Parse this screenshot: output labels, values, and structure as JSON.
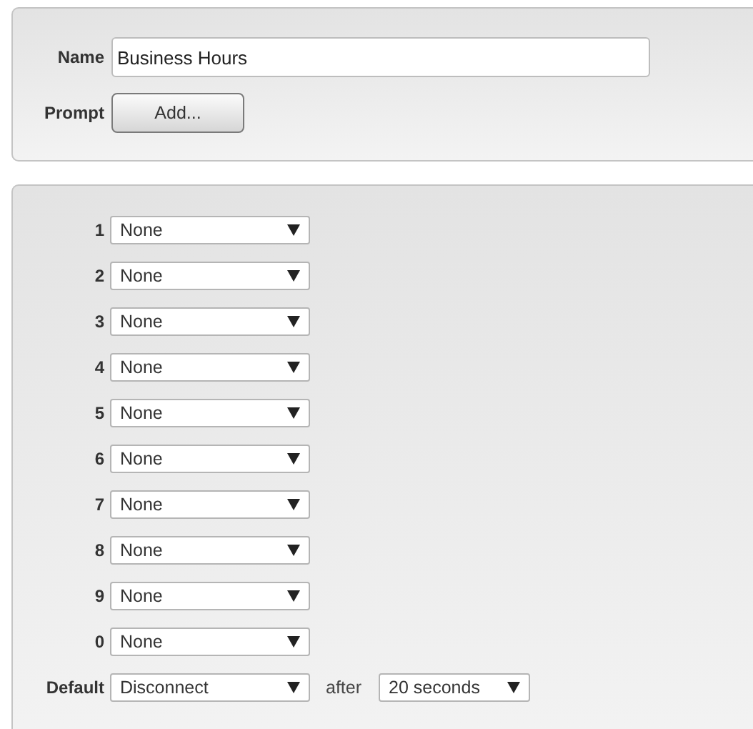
{
  "name_field": {
    "label": "Name",
    "value": "Business Hours"
  },
  "prompt": {
    "label": "Prompt",
    "button": "Add..."
  },
  "keys": [
    {
      "key": "1",
      "action": "None"
    },
    {
      "key": "2",
      "action": "None"
    },
    {
      "key": "3",
      "action": "None"
    },
    {
      "key": "4",
      "action": "None"
    },
    {
      "key": "5",
      "action": "None"
    },
    {
      "key": "6",
      "action": "None"
    },
    {
      "key": "7",
      "action": "None"
    },
    {
      "key": "8",
      "action": "None"
    },
    {
      "key": "9",
      "action": "None"
    },
    {
      "key": "0",
      "action": "None"
    }
  ],
  "default": {
    "label": "Default",
    "action": "Disconnect",
    "after_label": "after",
    "timeout": "20 seconds"
  }
}
